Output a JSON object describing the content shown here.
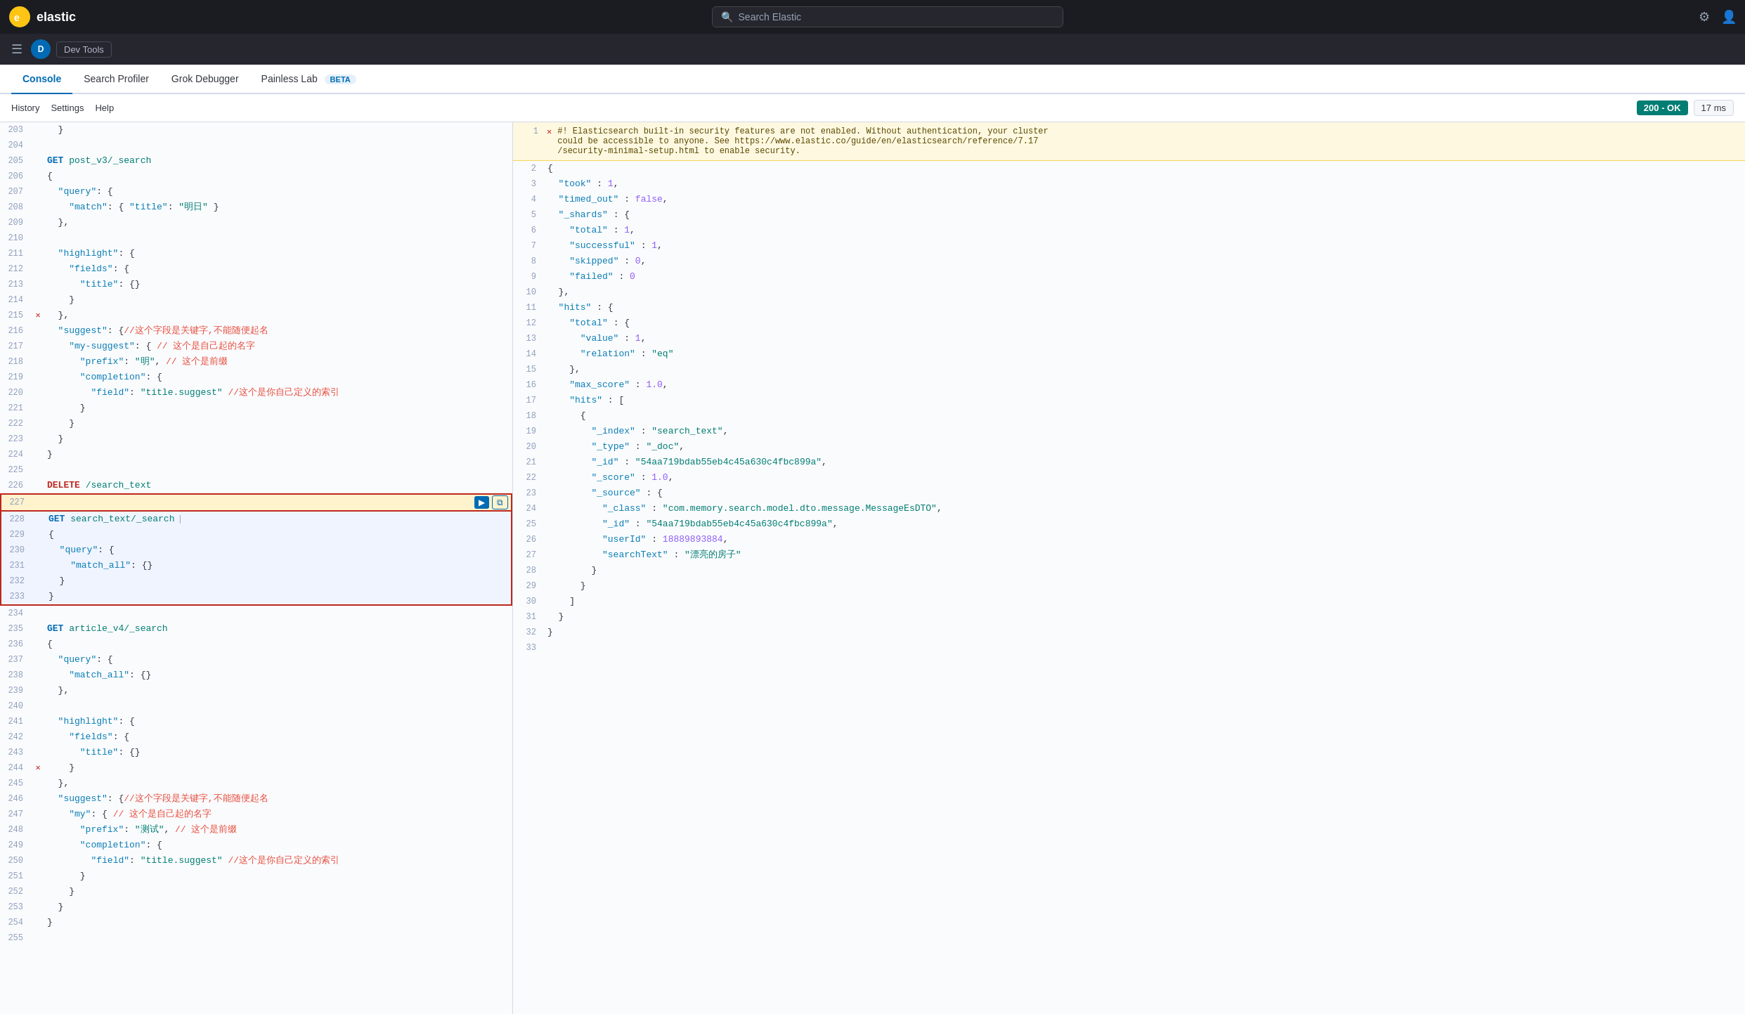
{
  "topNav": {
    "logoAlt": "Elastic",
    "searchPlaceholder": "Search Elastic",
    "navIcon1": "⚙",
    "navIcon2": "👤"
  },
  "secondBar": {
    "userInitial": "D",
    "devToolsLabel": "Dev Tools"
  },
  "tabs": [
    {
      "id": "console",
      "label": "Console",
      "active": true
    },
    {
      "id": "search-profiler",
      "label": "Search Profiler",
      "active": false
    },
    {
      "id": "grok-debugger",
      "label": "Grok Debugger",
      "active": false
    },
    {
      "id": "painless-lab",
      "label": "Painless Lab",
      "active": false,
      "beta": true
    }
  ],
  "subBar": {
    "links": [
      "History",
      "Settings",
      "Help"
    ],
    "status": "200 - OK",
    "time": "17 ms"
  },
  "editorLines": [
    {
      "num": "203",
      "content": "  }"
    },
    {
      "num": "204",
      "content": ""
    },
    {
      "num": "205",
      "content": "GET post_v3/_search",
      "method": "GET"
    },
    {
      "num": "206",
      "content": "{"
    },
    {
      "num": "207",
      "content": "  \"query\": {"
    },
    {
      "num": "208",
      "content": "    \"match\": { \"title\": \"明日\" }"
    },
    {
      "num": "209",
      "content": "  },"
    },
    {
      "num": "210",
      "content": ""
    },
    {
      "num": "211",
      "content": "  \"highlight\": {"
    },
    {
      "num": "212",
      "content": "    \"fields\": {"
    },
    {
      "num": "213",
      "content": "      \"title\": {}"
    },
    {
      "num": "214",
      "content": "    }"
    },
    {
      "num": "215",
      "content": "  },",
      "hasError": true
    },
    {
      "num": "216",
      "content": "  \"suggest\": {//这个字段是关键字,不能随便起名",
      "hasComment": true
    },
    {
      "num": "217",
      "content": "    \"my-suggest\": { // 这个是自己起的名字",
      "hasComment": true
    },
    {
      "num": "218",
      "content": "      \"prefix\": \"明\", // 这个是前缀",
      "hasComment": true
    },
    {
      "num": "219",
      "content": "      \"completion\": {"
    },
    {
      "num": "220",
      "content": "        \"field\": \"title.suggest\" //这个是你自己定义的索引",
      "hasComment": true
    },
    {
      "num": "221",
      "content": "      }"
    },
    {
      "num": "222",
      "content": "    }"
    },
    {
      "num": "223",
      "content": "  }"
    },
    {
      "num": "224",
      "content": "}"
    },
    {
      "num": "225",
      "content": ""
    },
    {
      "num": "226",
      "content": "DELETE /search_text",
      "method": "DELETE"
    },
    {
      "num": "227",
      "content": "",
      "isActiveLine": true
    },
    {
      "num": "228",
      "content": "GET search_text/_search",
      "method": "GET",
      "isActiveBlock": true,
      "showActions": true
    },
    {
      "num": "229",
      "content": "{",
      "isActiveBlock": true
    },
    {
      "num": "230",
      "content": "  \"query\": {",
      "isActiveBlock": true
    },
    {
      "num": "231",
      "content": "    \"match_all\": {}",
      "isActiveBlock": true
    },
    {
      "num": "232",
      "content": "  }",
      "isActiveBlock": true
    },
    {
      "num": "233",
      "content": "}",
      "isActiveBlock": true
    },
    {
      "num": "234",
      "content": ""
    },
    {
      "num": "235",
      "content": "GET article_v4/_search",
      "method": "GET"
    },
    {
      "num": "236",
      "content": "{"
    },
    {
      "num": "237",
      "content": "  \"query\": {"
    },
    {
      "num": "238",
      "content": "    \"match_all\": {}"
    },
    {
      "num": "239",
      "content": "  },"
    },
    {
      "num": "240",
      "content": ""
    },
    {
      "num": "241",
      "content": "  \"highlight\": {"
    },
    {
      "num": "242",
      "content": "    \"fields\": {"
    },
    {
      "num": "243",
      "content": "      \"title\": {}"
    },
    {
      "num": "244",
      "content": "    }",
      "hasError": true
    },
    {
      "num": "245",
      "content": "  },",
      "hasError": false
    },
    {
      "num": "246",
      "content": "  \"suggest\": {//这个字段是关键字,不能随便起名",
      "hasComment": true
    },
    {
      "num": "247",
      "content": "    \"my\": { // 这个是自己起的名字",
      "hasComment": true
    },
    {
      "num": "248",
      "content": "      \"prefix\": \"测试\", // 这个是前缀",
      "hasComment": true
    },
    {
      "num": "249",
      "content": "      \"completion\": {"
    },
    {
      "num": "250",
      "content": "        \"field\": \"title.suggest\" //这个是你自己定义的索引",
      "hasComment": true
    },
    {
      "num": "251",
      "content": "      }"
    },
    {
      "num": "252",
      "content": "    }"
    },
    {
      "num": "253",
      "content": "  }"
    },
    {
      "num": "254",
      "content": "}"
    },
    {
      "num": "255",
      "content": ""
    }
  ],
  "responseWarning": "#! Elasticsearch built-in security features are not enabled. Without authentication, your cluster could be accessible to anyone. See https://www.elastic.co/guide/en/elasticsearch/reference/7.17/security-minimal-setup.html to enable security.",
  "responseLines": [
    {
      "num": "2",
      "content": "{"
    },
    {
      "num": "3",
      "content": "  \"took\" : 1,"
    },
    {
      "num": "4",
      "content": "  \"timed_out\" : false,"
    },
    {
      "num": "5",
      "content": "  \"_shards\" : {"
    },
    {
      "num": "6",
      "content": "    \"total\" : 1,"
    },
    {
      "num": "7",
      "content": "    \"successful\" : 1,"
    },
    {
      "num": "8",
      "content": "    \"skipped\" : 0,"
    },
    {
      "num": "9",
      "content": "    \"failed\" : 0"
    },
    {
      "num": "10",
      "content": "  },"
    },
    {
      "num": "11",
      "content": "  \"hits\" : {"
    },
    {
      "num": "12",
      "content": "    \"total\" : {"
    },
    {
      "num": "13",
      "content": "      \"value\" : 1,"
    },
    {
      "num": "14",
      "content": "      \"relation\" : \"eq\""
    },
    {
      "num": "15",
      "content": "    },"
    },
    {
      "num": "16",
      "content": "    \"max_score\" : 1.0,"
    },
    {
      "num": "17",
      "content": "    \"hits\" : ["
    },
    {
      "num": "18",
      "content": "      {"
    },
    {
      "num": "19",
      "content": "        \"_index\" : \"search_text\","
    },
    {
      "num": "20",
      "content": "        \"_type\" : \"_doc\","
    },
    {
      "num": "21",
      "content": "        \"_id\" : \"54aa719bdab55eb4c45a630c4fbc899a\","
    },
    {
      "num": "22",
      "content": "        \"_score\" : 1.0,"
    },
    {
      "num": "23",
      "content": "        \"_source\" : {"
    },
    {
      "num": "24",
      "content": "          \"_class\" : \"com.memory.search.model.dto.message.MessageEsDTO\","
    },
    {
      "num": "25",
      "content": "          \"_id\" : \"54aa719bdab55eb4c45a630c4fbc899a\","
    },
    {
      "num": "26",
      "content": "          \"userId\" : 18889893884,"
    },
    {
      "num": "27",
      "content": "          \"searchText\" : \"漂亮的房子\""
    },
    {
      "num": "28",
      "content": "        }"
    },
    {
      "num": "29",
      "content": "      }"
    },
    {
      "num": "30",
      "content": "    ]"
    },
    {
      "num": "31",
      "content": "  }"
    },
    {
      "num": "32",
      "content": "}"
    },
    {
      "num": "33",
      "content": ""
    }
  ]
}
